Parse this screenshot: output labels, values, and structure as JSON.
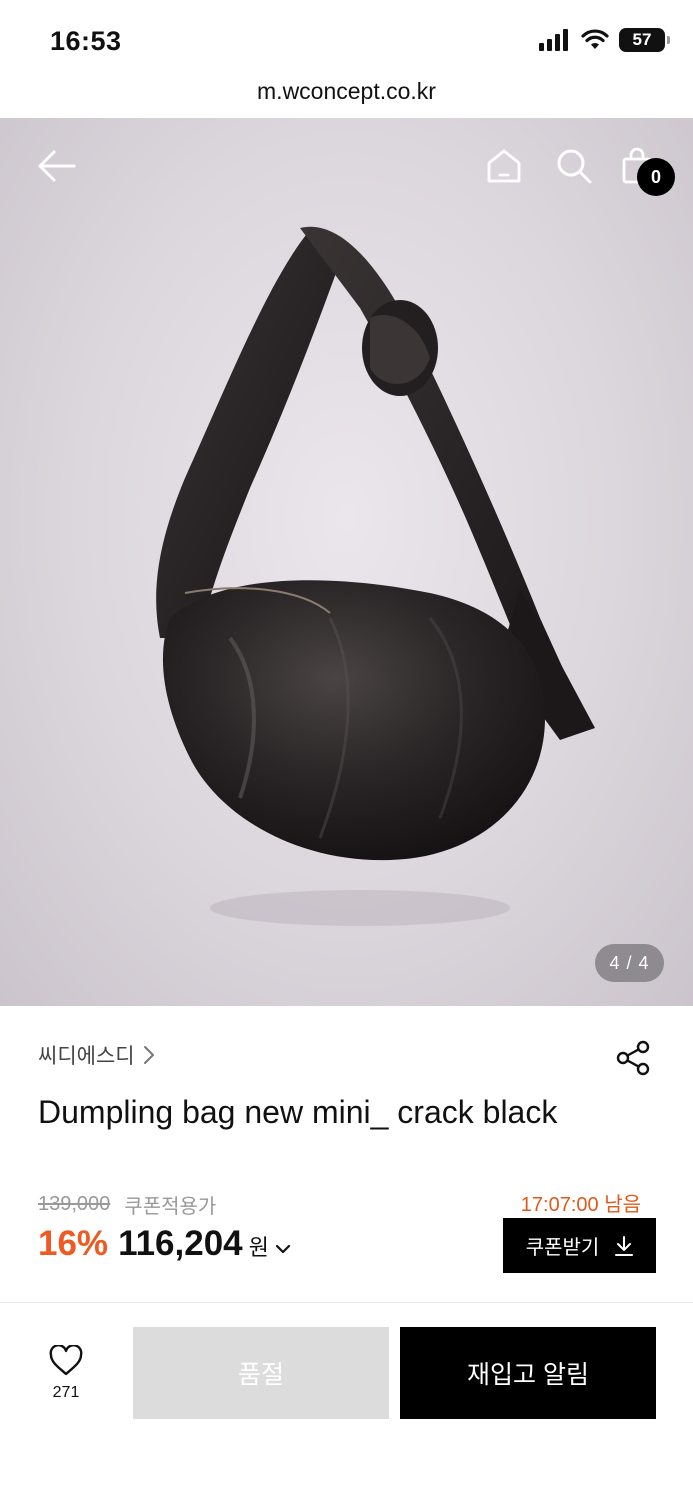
{
  "status_bar": {
    "time": "16:53",
    "battery": "57"
  },
  "browser": {
    "url": "m.wconcept.co.kr"
  },
  "header": {
    "cart_count": "0"
  },
  "gallery": {
    "counter": "4 / 4"
  },
  "product": {
    "brand": "씨디에스디",
    "title": "Dumpling bag new mini_ crack black",
    "original_price": "139,000",
    "coupon_label": "쿠폰적용가",
    "countdown": "17:07:00 남음",
    "discount": "16%",
    "sale_price": "116,204",
    "currency": "원"
  },
  "actions": {
    "coupon_button": "쿠폰받기",
    "wishlist_count": "271",
    "soldout_button": "품절",
    "restock_button": "재입고 알림"
  },
  "colors": {
    "accent": "#ef5a22",
    "countdown": "#e05a1b"
  }
}
